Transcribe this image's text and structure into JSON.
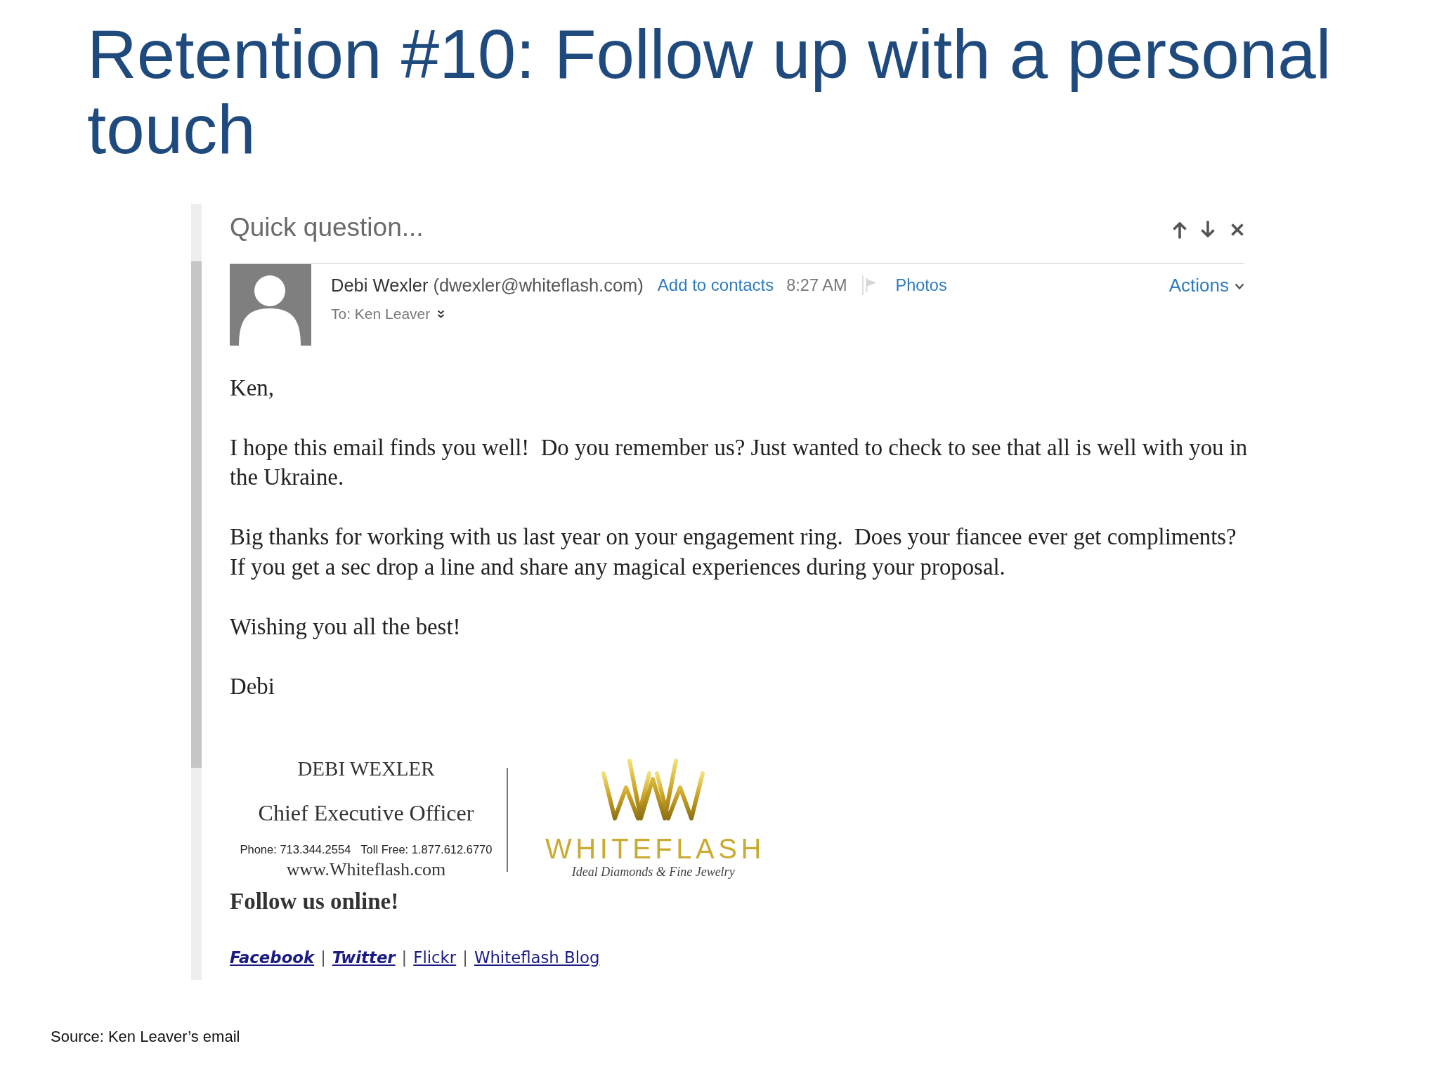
{
  "slide": {
    "title": "Retention #10: Follow up with a personal touch",
    "source": "Source: Ken Leaver’s email"
  },
  "email": {
    "subject": "Quick question...",
    "sender_name": "Debi Wexler",
    "sender_address": "(dwexler@whiteflash.com)",
    "add_contact": "Add to contacts",
    "time": "8:27 AM",
    "photos": "Photos",
    "actions": "Actions",
    "to": "To: Ken Leaver",
    "body": [
      "Ken,",
      "I hope this email finds you well!  Do you remember us? Just wanted to check to see that all is well with you in the Ukraine.",
      "Big thanks for working with us last year on your engagement ring.  Does your fiancee ever get compliments? If you get a sec drop a line and share any magical experiences during your proposal.",
      "Wishing you all the best!",
      "Debi"
    ],
    "signature": {
      "name": "DEBI WEXLER",
      "position": "Chief Executive Officer",
      "phone": "Phone: 713.344.2554",
      "toll_free": "Toll Free: 1.877.612.6770",
      "website": "www.Whiteflash.com",
      "logo": {
        "wordmark": "WHITEFLASH",
        "tagline": "Ideal Diamonds & Fine Jewelry"
      }
    },
    "follow_heading": "Follow us online!",
    "social_links": [
      {
        "kind": "strong_link",
        "label": "Facebook"
      },
      {
        "kind": "separator",
        "label": "|"
      },
      {
        "kind": "strong_link",
        "label": "Twitter"
      },
      {
        "kind": "separator",
        "label": "|"
      },
      {
        "kind": "link",
        "label": "Flickr"
      },
      {
        "kind": "separator",
        "label": "|"
      },
      {
        "kind": "link",
        "label": "Whiteflash Blog"
      }
    ]
  }
}
